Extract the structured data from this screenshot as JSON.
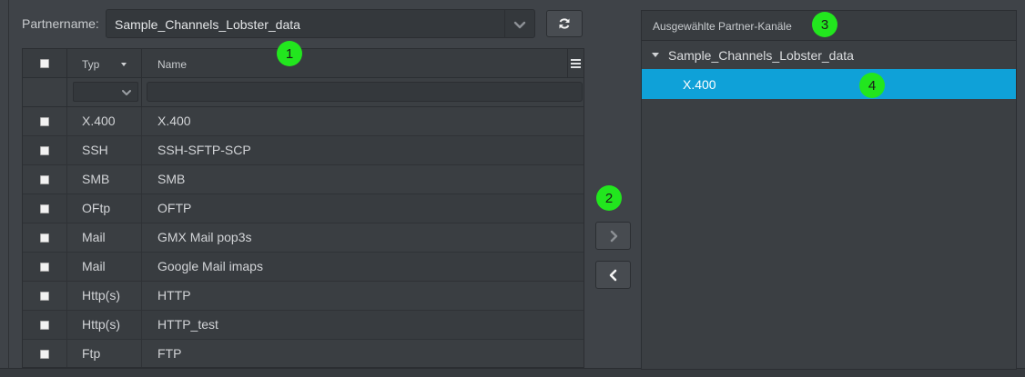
{
  "partner": {
    "label": "Partnername:",
    "selected": "Sample_Channels_Lobster_data"
  },
  "grid": {
    "columns": {
      "typ": "Typ",
      "name": "Name"
    },
    "filter_name_placeholder": "",
    "rows": [
      {
        "typ": "X.400",
        "name": "X.400"
      },
      {
        "typ": "SSH",
        "name": "SSH-SFTP-SCP"
      },
      {
        "typ": "SMB",
        "name": "SMB"
      },
      {
        "typ": "OFtp",
        "name": "OFTP"
      },
      {
        "typ": "Mail",
        "name": "GMX Mail pop3s"
      },
      {
        "typ": "Mail",
        "name": "Google Mail imaps"
      },
      {
        "typ": "Http(s)",
        "name": "HTTP"
      },
      {
        "typ": "Http(s)",
        "name": "HTTP_test"
      },
      {
        "typ": "Ftp",
        "name": "FTP"
      }
    ]
  },
  "selected_panel": {
    "title": "Ausgewählte Partner-Kanäle",
    "root": "Sample_Channels_Lobster_data",
    "child": "X.400"
  },
  "callouts": [
    "1",
    "2",
    "3",
    "4"
  ],
  "colors": {
    "background": "#3f4348",
    "selection": "#0fa1d8",
    "callout": "#22e61e"
  },
  "icons": {
    "refresh": "refresh-icon",
    "dropdown": "chevron-down-icon",
    "move_right": "chevron-right-icon",
    "move_left": "chevron-left-icon",
    "menu": "hamburger-menu-icon",
    "expand": "caret-down-icon"
  }
}
